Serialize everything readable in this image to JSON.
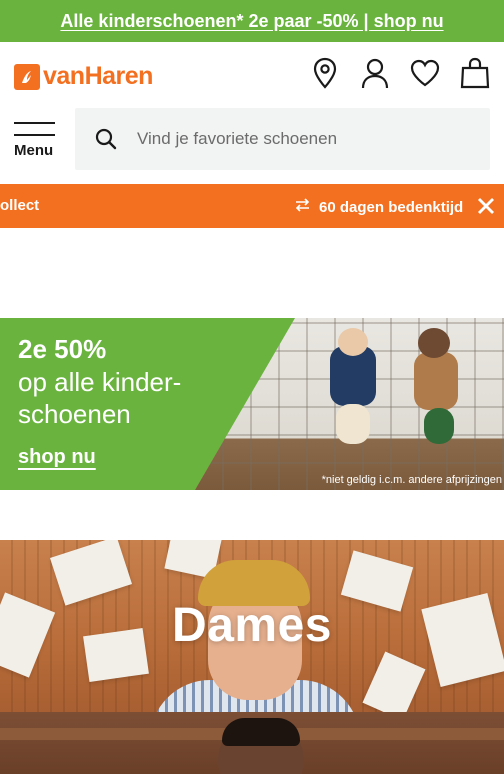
{
  "promo": {
    "text": "Alle kinderschoenen* 2e paar -50% | shop nu"
  },
  "header": {
    "logo_text": "vanHaren",
    "icons": [
      "location-pin-icon",
      "account-icon",
      "heart-icon",
      "shopping-bag-icon"
    ]
  },
  "menu": {
    "label": "Menu"
  },
  "search": {
    "placeholder": "Vind je favoriete schoenen"
  },
  "usp": {
    "left_text": "ollect",
    "right_text": "60 dagen bedenktijd"
  },
  "banner": {
    "line1": "2e 50%",
    "line2": "op alle kinder-schoenen",
    "cta": "shop nu",
    "note": "*niet geldig i.c.m. andere afprijzingen"
  },
  "categories": [
    {
      "label": "Dames"
    },
    {
      "label": ""
    }
  ],
  "colors": {
    "brand_orange": "#f37021",
    "promo_green": "#6ab33e",
    "search_bg": "#f2f3f3"
  }
}
